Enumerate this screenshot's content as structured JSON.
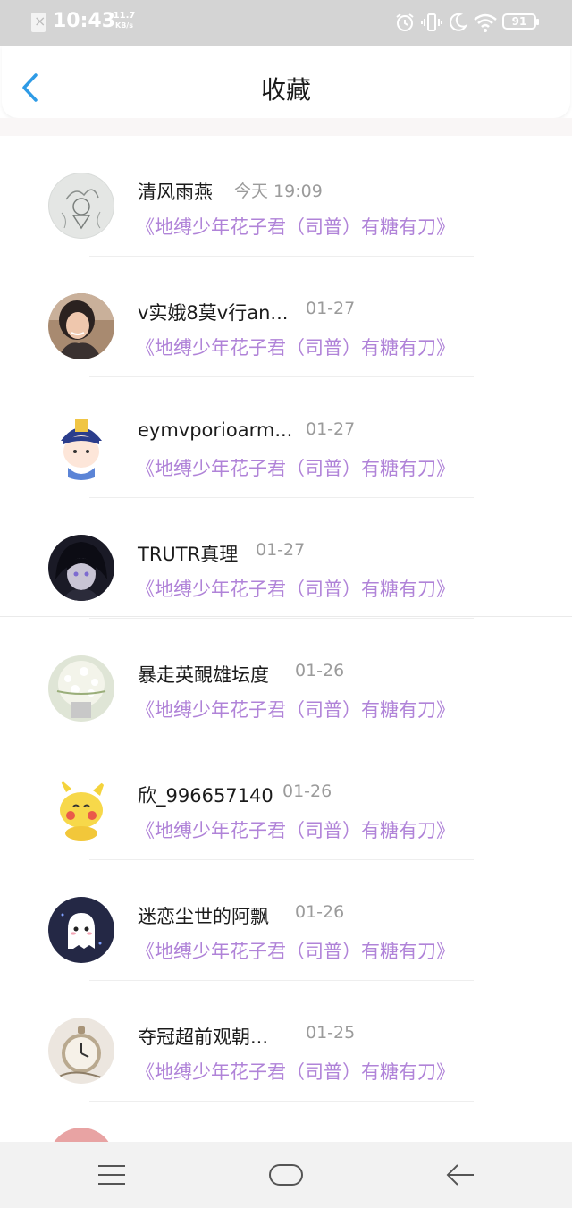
{
  "status_bar": {
    "time": "10:43",
    "speed_value": "11.7",
    "speed_unit": "KB/s",
    "battery": "91"
  },
  "header": {
    "title": "收藏"
  },
  "items": [
    {
      "name": "清风雨燕",
      "time": "今天 19:09",
      "link": "《地缚少年花子君（司普）有糖有刀》",
      "avatar": "sketch-avatar"
    },
    {
      "name": "v实娥8莫v行an...",
      "time": "01-27",
      "link": "《地缚少年花子君（司普）有糖有刀》",
      "avatar": "girl-photo-avatar"
    },
    {
      "name": "eymvporioarm...",
      "time": "01-27",
      "link": "《地缚少年花子君（司普）有糖有刀》",
      "avatar": "cartoon-jiangshi-avatar"
    },
    {
      "name": "TRUTR真理",
      "time": "01-27",
      "link": "《地缚少年花子君（司普）有糖有刀》",
      "avatar": "dark-anime-avatar"
    },
    {
      "name": "暴走英靦雄坛度",
      "time": "01-26",
      "link": "《地缚少年花子君（司普）有糖有刀》",
      "avatar": "flowers-avatar"
    },
    {
      "name": "欣_996657140",
      "time": "01-26",
      "link": "《地缚少年花子君（司普）有糖有刀》",
      "avatar": "pikachu-avatar"
    },
    {
      "name": "迷恋尘世的阿飘",
      "time": "01-26",
      "link": "《地缚少年花子君（司普）有糖有刀》",
      "avatar": "ghost-avatar"
    },
    {
      "name": "夺冠超前观朝...",
      "time": "01-25",
      "link": "《地缚少年花子君（司普）有糖有刀》",
      "avatar": "pocket-watch-avatar"
    }
  ],
  "colors": {
    "link": "#b083d8",
    "back_arrow": "#2e9be6",
    "time": "#9b9b9b"
  }
}
